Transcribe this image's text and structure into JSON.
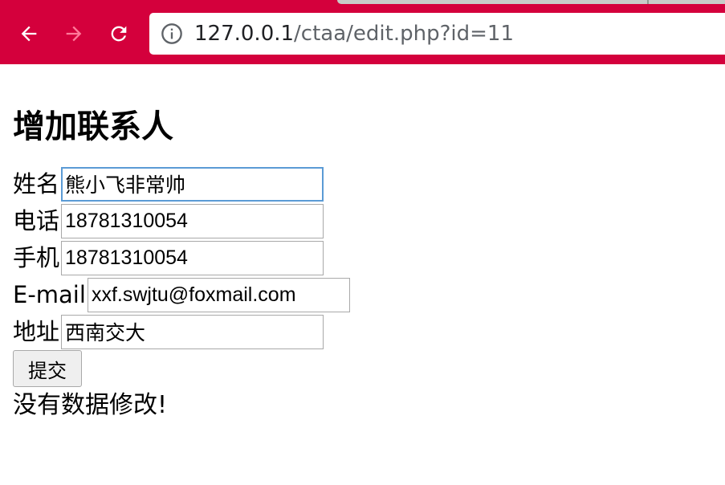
{
  "browser": {
    "address_host": "127.0.0.1",
    "address_path": "/ctaa/edit.php?id=11"
  },
  "page": {
    "heading": "增加联系人",
    "fields": [
      {
        "label": "姓名",
        "value": "熊小飞非常帅"
      },
      {
        "label": "电话",
        "value": "18781310054"
      },
      {
        "label": "手机",
        "value": "18781310054"
      },
      {
        "label": "E-mail",
        "value": "xxf.swjtu@foxmail.com"
      },
      {
        "label": "地址",
        "value": "西南交大"
      }
    ],
    "submit_label": "提交",
    "message": "没有数据修改!"
  },
  "colors": {
    "toolbar": "#d4003c",
    "focus_ring": "#5b9bd5"
  }
}
